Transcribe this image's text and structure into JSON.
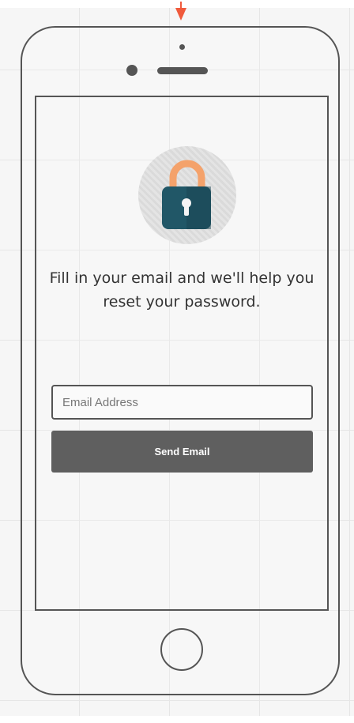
{
  "screen": {
    "message": "Fill in your email and we'll help you reset your password.",
    "email": {
      "placeholder": "Email Address",
      "value": ""
    },
    "send_button_label": "Send Email"
  },
  "icons": {
    "lock": "padlock-icon",
    "pointer": "red-arrow-marker"
  },
  "colors": {
    "lock_shackle": "#f4a26b",
    "lock_body": "#215767",
    "lock_body_shade": "#1a4452",
    "button": "#5f5f5f"
  }
}
